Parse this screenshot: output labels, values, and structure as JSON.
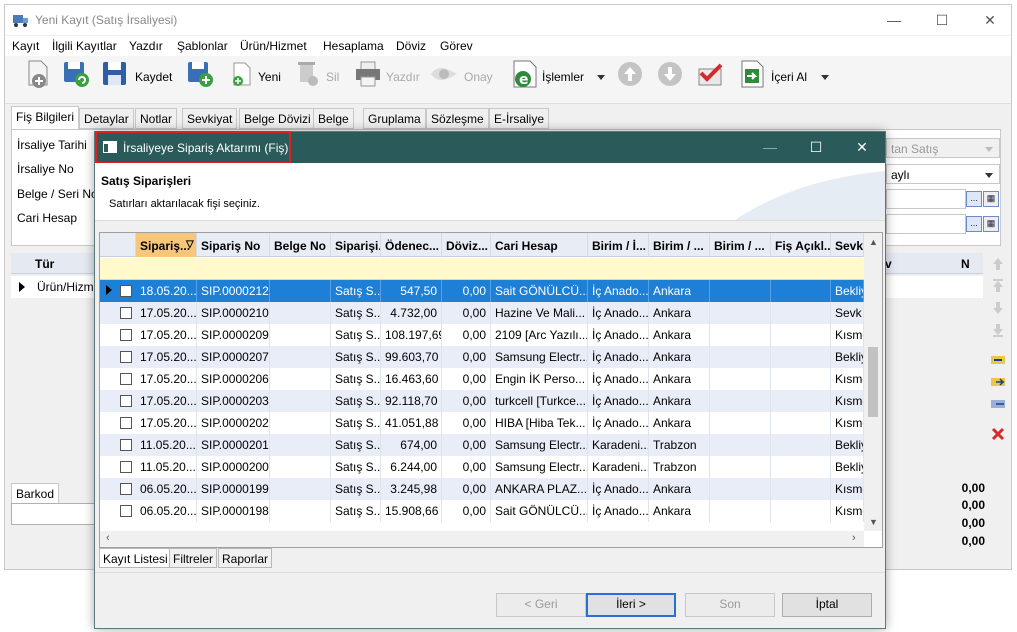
{
  "window": {
    "title": "Yeni Kayıt (Satış İrsaliyesi)",
    "minimize": "—",
    "maximize": "☐",
    "close": "✕"
  },
  "menu": [
    "Kayıt",
    "İlgili Kayıtlar",
    "Yazdır",
    "Şablonlar",
    "Ürün/Hizmet",
    "Hesaplama",
    "Döviz",
    "Görev"
  ],
  "toolbar": {
    "kaydet": "Kaydet",
    "yeni": "Yeni",
    "sil": "Sil",
    "yazdir": "Yazdır",
    "onay": "Onay",
    "islemler": "İşlemler",
    "iceri_al": "İçeri Al"
  },
  "tabs": [
    "Fiş Bilgileri",
    "Detaylar",
    "Notlar",
    "Sevkiyat",
    "Belge Dövizi",
    "Belge",
    "Gruplama",
    "Sözleşme",
    "E-İrsaliye"
  ],
  "form": {
    "labels": [
      "İrsaliye Tarihi",
      "İrsaliye No",
      "Belge / Seri No",
      "Cari Hesap"
    ],
    "right_field_1": "tan Satış",
    "right_field_2": "aylı"
  },
  "grid": {
    "col_tur": "Tür",
    "col_n": "N",
    "col_v": "v",
    "row_value": "Ürün/Hizm"
  },
  "barkod": {
    "tab": "Barkod"
  },
  "totals": [
    "0,00",
    "0,00",
    "0,00",
    "0,00"
  ],
  "dialog": {
    "title": "İrsaliyeye Sipariş Aktarımı (Fiş)",
    "heading": "Satış Siparişleri",
    "subheading": "Satırları aktarılacak fişi seçiniz.",
    "columns": [
      "Sipariş...",
      "Sipariş No",
      "Belge No",
      "Siparişi...",
      "Ödenec...",
      "Döviz...",
      "Cari Hesap",
      "Birim / İ...",
      "Birim / ...",
      "Birim / ...",
      "Fiş Açıkl...",
      "Sevk"
    ],
    "rows": [
      [
        "18.05.20...",
        "SIP.0000212",
        "",
        "Satış S...",
        "547,50",
        "0,00",
        "Sait GÖNÜLCÜ...",
        "İç Anado...",
        "Ankara",
        "",
        "",
        "Bekliy"
      ],
      [
        "17.05.20...",
        "SIP.0000210",
        "",
        "Satış S...",
        "4.732,00",
        "0,00",
        "Hazine Ve Mali...",
        "İç Anado...",
        "Ankara",
        "",
        "",
        "Sevk C"
      ],
      [
        "17.05.20...",
        "SIP.0000209",
        "",
        "Satış S...",
        "108.197,69",
        "0,00",
        "2109 [Arc Yazılı...",
        "İç Anado...",
        "Ankara",
        "",
        "",
        "Kısme"
      ],
      [
        "17.05.20...",
        "SIP.0000207",
        "",
        "Satış S...",
        "99.603,70",
        "0,00",
        "Samsung Electr...",
        "İç Anado...",
        "Ankara",
        "",
        "",
        "Bekliy"
      ],
      [
        "17.05.20...",
        "SIP.0000206",
        "",
        "Satış S...",
        "16.463,60",
        "0,00",
        "Engin İK Perso...",
        "İç Anado...",
        "Ankara",
        "",
        "",
        "Kısme"
      ],
      [
        "17.05.20...",
        "SIP.0000203",
        "",
        "Satış S...",
        "92.118,70",
        "0,00",
        "turkcell [Turkce...",
        "İç Anado...",
        "Ankara",
        "",
        "",
        "Kısme"
      ],
      [
        "17.05.20...",
        "SIP.0000202",
        "",
        "Satış S...",
        "41.051,88",
        "0,00",
        "HIBA [Hiba Tek...",
        "İç Anado...",
        "Ankara",
        "",
        "",
        "Kısme"
      ],
      [
        "11.05.20...",
        "SIP.0000201",
        "",
        "Satış S...",
        "674,00",
        "0,00",
        "Samsung Electr...",
        "Karadeni...",
        "Trabzon",
        "",
        "",
        "Bekliy"
      ],
      [
        "11.05.20...",
        "SIP.0000200",
        "",
        "Satış S...",
        "6.244,00",
        "0,00",
        "Samsung Electr...",
        "Karadeni...",
        "Trabzon",
        "",
        "",
        "Bekliy"
      ],
      [
        "06.05.20...",
        "SIP.0000199",
        "",
        "Satış S...",
        "3.245,98",
        "0,00",
        "ANKARA PLAZ...",
        "İç Anado...",
        "Ankara",
        "",
        "",
        "Kısme"
      ],
      [
        "06.05.20...",
        "SIP.0000198",
        "",
        "Satış S...",
        "15.908,66",
        "0,00",
        "Sait GÖNÜLCÜ...",
        "İç Anado...",
        "Ankara",
        "",
        "",
        "Kısme"
      ]
    ],
    "bottom_tabs": [
      "Kayıt Listesi",
      "Filtreler",
      "Raporlar"
    ],
    "buttons": {
      "back": "< Geri",
      "next": "İleri >",
      "finish": "Son",
      "cancel": "İptal"
    }
  },
  "colors": {
    "dialog_title_bg": "#2b5a5a",
    "selected_row": "#1e7fd6",
    "sort_header": "#f7c67a",
    "filter_row": "#fff9cc",
    "highlight_box": "#e02020"
  }
}
